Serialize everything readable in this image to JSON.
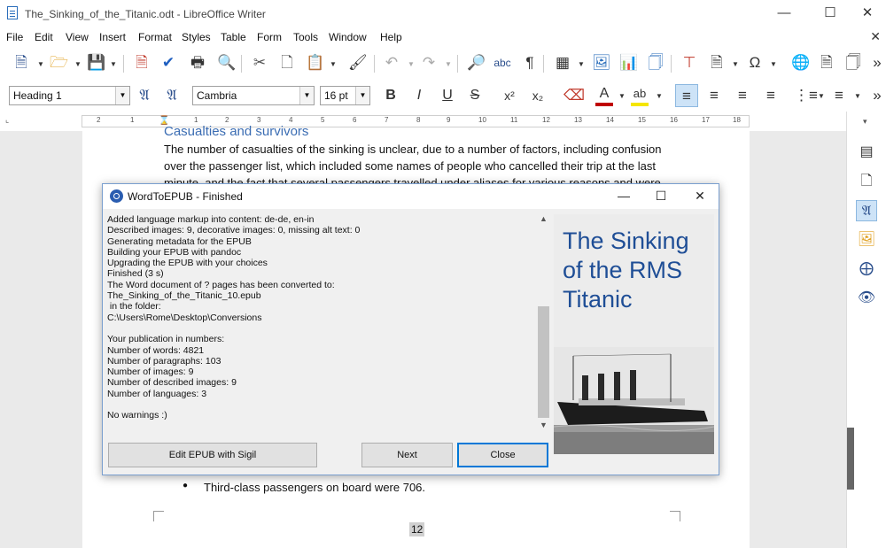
{
  "window": {
    "title": "The_Sinking_of_the_Titanic.odt - LibreOffice Writer"
  },
  "menu": [
    "File",
    "Edit",
    "View",
    "Insert",
    "Format",
    "Styles",
    "Table",
    "Form",
    "Tools",
    "Window",
    "Help"
  ],
  "formatting": {
    "paragraph_style": "Heading 1",
    "font_name": "Cambria",
    "font_size": "16 pt"
  },
  "ruler": {
    "labels": [
      "2",
      "1",
      "1",
      "2",
      "3",
      "4",
      "5",
      "6",
      "7",
      "8",
      "9",
      "10",
      "11",
      "12",
      "13",
      "14",
      "15",
      "16",
      "17",
      "18"
    ]
  },
  "document": {
    "heading_partial": "Casualties and survivors",
    "para_line1": "The number of casualties of the sinking is unclear, due to a number of factors, including confusion",
    "para_line2": "over the passenger list, which included some names of people who cancelled their trip at the last",
    "para_line3": "minute, and the fact that several passengers travelled under aliases for various reasons and were",
    "bullet": "Third-class passengers on board were 706.",
    "page_number": "12"
  },
  "dialog": {
    "title": "WordToEPUB - Finished",
    "log_lines": [
      "Added language markup into content: de-de, en-in",
      "Described images: 9, decorative images: 0, missing alt text: 0",
      "Generating metadata for the EPUB",
      "Building your EPUB with pandoc",
      "Upgrading the EPUB with your choices",
      "Finished (3 s)",
      "The Word document of ? pages has been converted to:",
      "The_Sinking_of_the_Titanic_10.epub",
      " in the folder:",
      "C:\\Users\\Rome\\Desktop\\Conversions",
      "",
      "Your publication in numbers:",
      "Number of words: 4821",
      "Number of paragraphs: 103",
      "Number of images: 9",
      "Number of described images: 9",
      "Number of languages: 3",
      "",
      "No warnings :)"
    ],
    "cover_title": "The Sinking of the RMS Titanic",
    "buttons": {
      "edit": "Edit EPUB with Sigil",
      "next": "Next",
      "close": "Close"
    }
  },
  "colors": {
    "accent": "#0078d7",
    "heading_blue": "#1f4e96",
    "toolbar_blue": "#2a4e8c"
  }
}
